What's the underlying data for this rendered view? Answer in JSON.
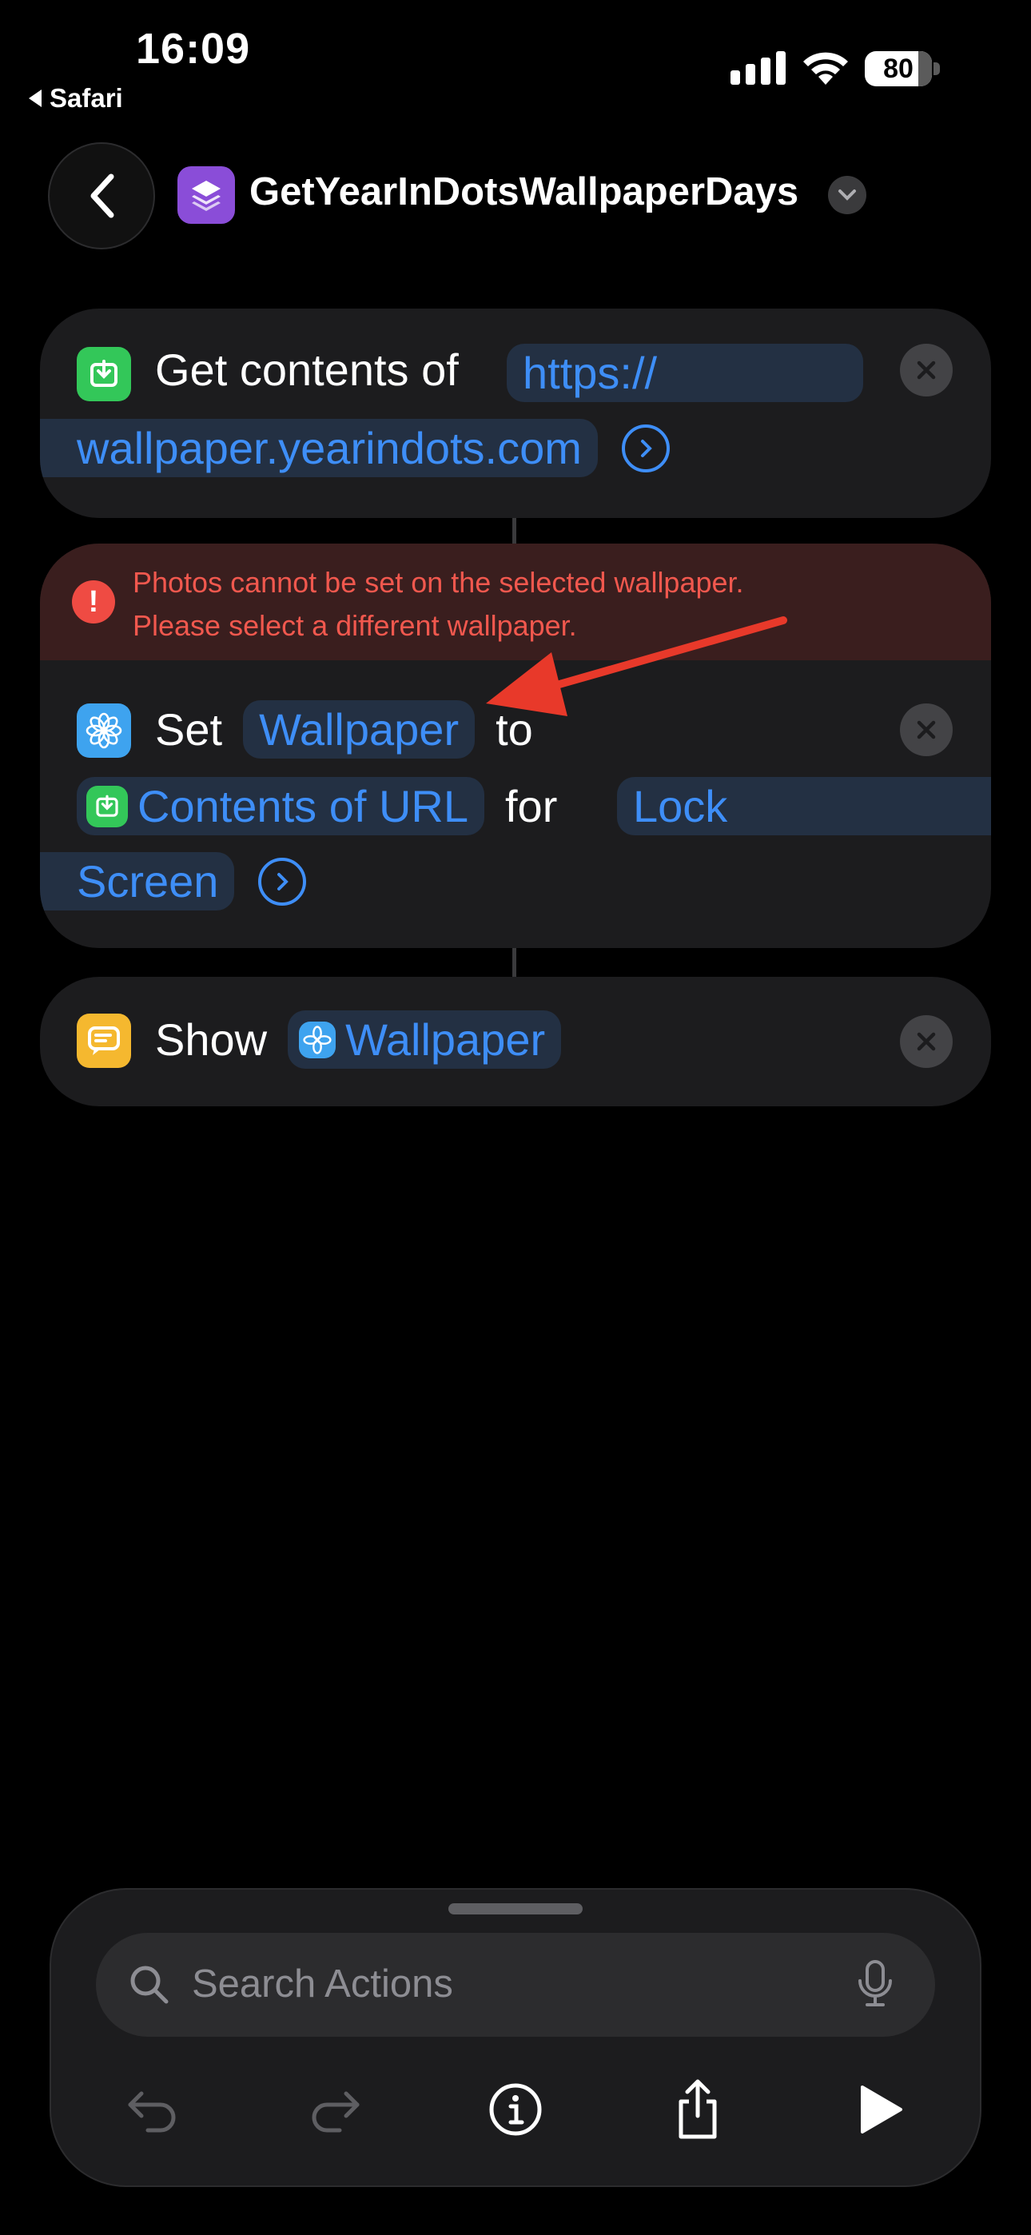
{
  "status_bar": {
    "time": "16:09",
    "back_app": "Safari",
    "battery": "80",
    "battery_level": 0.8
  },
  "nav": {
    "title": "GetYearInDotsWallpaperDays"
  },
  "actions": [
    {
      "verb": "Get contents of",
      "url_line1": "https://",
      "url_line2": "wallpaper.yearindots.com"
    },
    {
      "error_line1": "Photos cannot be set on the selected wallpaper.",
      "error_line2": "Please select a different wallpaper.",
      "verb": "Set",
      "param": "Wallpaper",
      "to": "to",
      "value": "Contents of URL",
      "for": "for",
      "target_line1": "Lock",
      "target_line2": "Screen"
    },
    {
      "verb": "Show",
      "param": "Wallpaper"
    }
  ],
  "search": {
    "placeholder": "Search Actions"
  },
  "colors": {
    "accent": "#3e8ef7",
    "error": "#f1584e",
    "annotation_arrow": "#e8392a",
    "card": "#1c1c1e"
  },
  "icons": {
    "action1": "download-icon",
    "action2": "wallpaper-flower-icon",
    "action3": "show-result-icon",
    "toolbar": [
      "undo-icon",
      "redo-icon",
      "info-icon",
      "share-icon",
      "play-icon"
    ]
  }
}
